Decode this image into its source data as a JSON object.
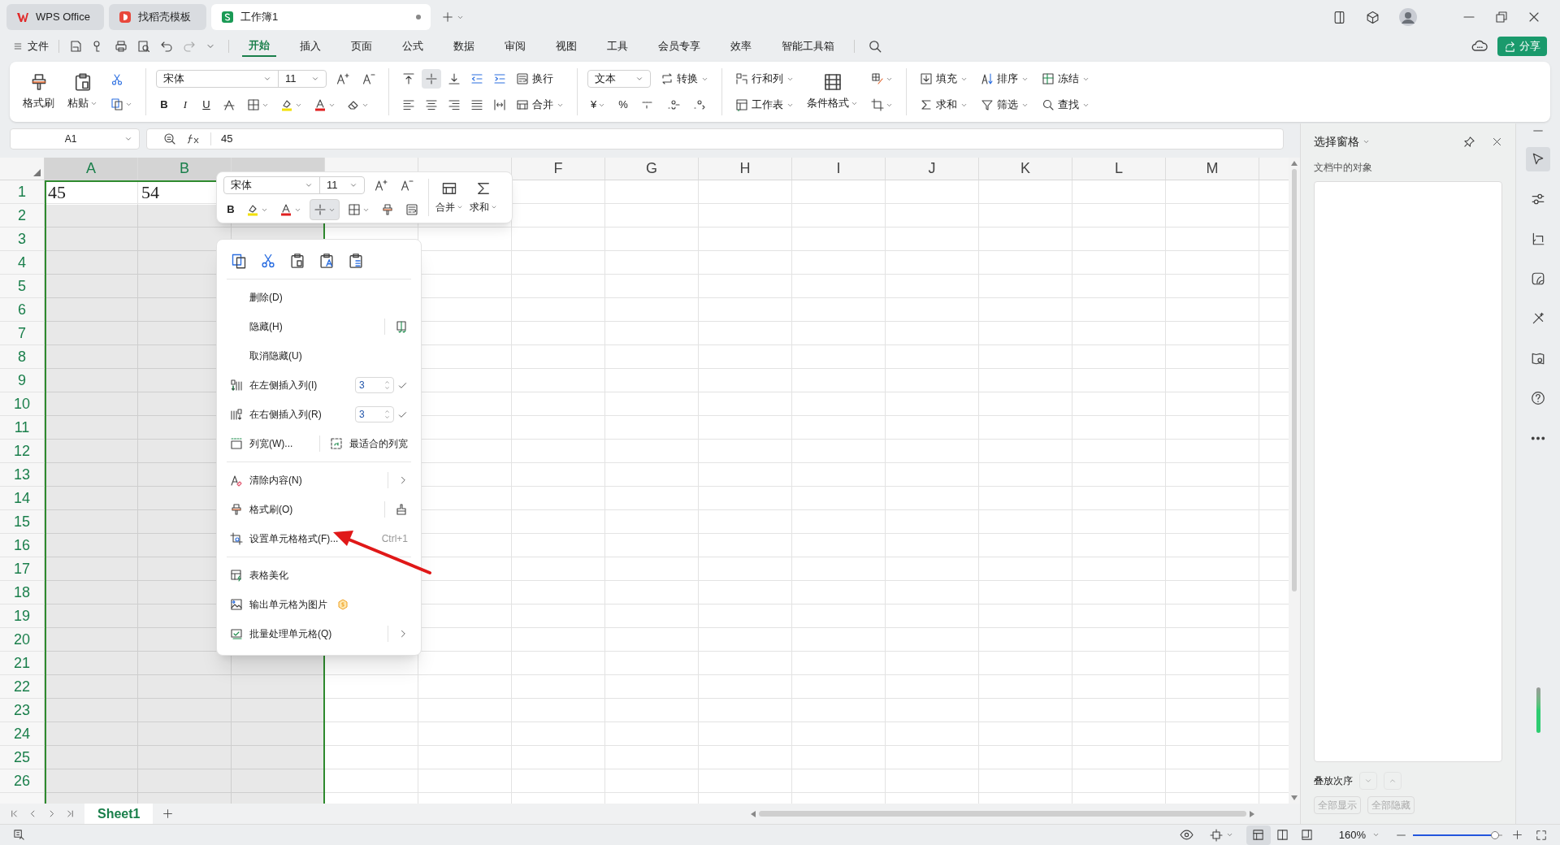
{
  "title_bar": {
    "tabs": [
      {
        "label": "WPS Office",
        "kind": "wps",
        "selected": false
      },
      {
        "label": "找稻壳模板",
        "kind": "docer",
        "selected": false
      },
      {
        "label": "工作簿1",
        "kind": "sheet",
        "selected": true
      }
    ]
  },
  "menu_bar": {
    "file": "文件",
    "tabs": [
      {
        "label": "开始",
        "selected": true
      },
      {
        "label": "插入",
        "selected": false
      },
      {
        "label": "页面",
        "selected": false
      },
      {
        "label": "公式",
        "selected": false
      },
      {
        "label": "数据",
        "selected": false
      },
      {
        "label": "审阅",
        "selected": false
      },
      {
        "label": "视图",
        "selected": false
      },
      {
        "label": "工具",
        "selected": false
      },
      {
        "label": "会员专享",
        "selected": false
      },
      {
        "label": "效率",
        "selected": false
      },
      {
        "label": "智能工具箱",
        "selected": false
      }
    ],
    "share": "分享"
  },
  "ribbon": {
    "format_painter": "格式刷",
    "paste": "粘贴",
    "font": "宋体",
    "font_size": "11",
    "text_styles": [
      "B",
      "I",
      "U"
    ],
    "align_buttons": [
      {
        "kind": "top",
        "selected": false
      },
      {
        "kind": "middle",
        "selected": true
      },
      {
        "kind": "bottom",
        "selected": false
      },
      {
        "kind": "outdent",
        "selected": false
      },
      {
        "kind": "indent",
        "selected": false
      }
    ],
    "wrap": "换行",
    "merge": "合并",
    "number_format": "文本",
    "convert": "转换",
    "currency": "¥",
    "percent": "%",
    "rows_cols": "行和列",
    "worksheet": "工作表",
    "conditional_format": "条件格式",
    "editing": [
      {
        "label": "填充",
        "kind": "fill"
      },
      {
        "label": "排序",
        "kind": "sort"
      },
      {
        "label": "冻结",
        "kind": "freeze"
      },
      {
        "label": "求和",
        "kind": "sum"
      },
      {
        "label": "筛选",
        "kind": "filter"
      },
      {
        "label": "查找",
        "kind": "find"
      }
    ]
  },
  "formula_bar": {
    "name_box": "A1",
    "formula": "45"
  },
  "sheet": {
    "columns": [
      {
        "label": "A",
        "selected": true
      },
      {
        "label": "B",
        "selected": true
      },
      {
        "selected": true
      },
      {
        "selected": false
      },
      {
        "selected": false
      },
      {
        "label": "F",
        "selected": false
      },
      {
        "label": "G",
        "selected": false
      },
      {
        "label": "H",
        "selected": false
      },
      {
        "label": "I",
        "selected": false
      },
      {
        "label": "J",
        "selected": false
      },
      {
        "label": "K",
        "selected": false
      },
      {
        "label": "L",
        "selected": false
      },
      {
        "label": "M",
        "selected": false
      }
    ],
    "rows": [
      {
        "label": "1",
        "cells": [
          "45",
          "54"
        ]
      },
      {
        "label": "2"
      },
      {
        "label": "3"
      },
      {
        "label": "4"
      },
      {
        "label": "5"
      },
      {
        "label": "6"
      },
      {
        "label": "7"
      },
      {
        "label": "8"
      },
      {
        "label": "9"
      },
      {
        "label": "10"
      },
      {
        "label": "11"
      },
      {
        "label": "12"
      },
      {
        "label": "13"
      },
      {
        "label": "14"
      },
      {
        "label": "15"
      },
      {
        "label": "16"
      },
      {
        "label": "17"
      },
      {
        "label": "18"
      },
      {
        "label": "19"
      },
      {
        "label": "20"
      },
      {
        "label": "21"
      },
      {
        "label": "22"
      },
      {
        "label": "23"
      },
      {
        "label": "24"
      },
      {
        "label": "25"
      },
      {
        "label": "26"
      },
      {}
    ]
  },
  "mini_toolbar": {
    "font": "宋体",
    "size": "11",
    "bold": "B",
    "merge": "合并",
    "sum": "求和"
  },
  "context_menu": {
    "quick_actions": [
      {
        "kind": "copy"
      },
      {
        "kind": "cut"
      },
      {
        "kind": "paste"
      },
      {
        "kind": "paste_text"
      },
      {
        "kind": "paste_special"
      }
    ],
    "sections": [
      [
        {
          "label": "删除(D)",
          "kind": "plain"
        },
        {
          "label": "隐藏(H)",
          "kind": "hide"
        },
        {
          "label": "取消隐藏(U)",
          "kind": "plain"
        },
        {
          "label": "在左侧插入列(I)",
          "kind": "insert_left",
          "count": "3"
        },
        {
          "label": "在右侧插入列(R)",
          "kind": "insert_right",
          "count": "3"
        },
        {
          "label": "列宽(W)...",
          "kind": "col_width",
          "split": "最适合的列宽"
        }
      ],
      [
        {
          "label": "清除内容(N)",
          "kind": "clear",
          "submenu": true
        },
        {
          "label": "格式刷(O)",
          "kind": "brush"
        },
        {
          "label": "设置单元格格式(F)...",
          "kind": "format",
          "shortcut": "Ctrl+1"
        }
      ],
      [
        {
          "label": "表格美化",
          "kind": "beautify"
        },
        {
          "label": "输出单元格为图片",
          "kind": "image",
          "premium": true
        },
        {
          "label": "批量处理单元格(Q)",
          "kind": "batch",
          "submenu": true
        }
      ]
    ]
  },
  "selection_pane": {
    "title": "选择窗格",
    "subtitle": "文档中的对象",
    "order_label": "叠放次序",
    "buttons": [
      {
        "label": "全部显示",
        "disabled": true
      },
      {
        "label": "全部隐藏",
        "disabled": true
      }
    ]
  },
  "side_toolbar": [
    {
      "kind": "select",
      "selected": true
    },
    {
      "kind": "properties",
      "selected": false
    },
    {
      "kind": "transform",
      "selected": false
    },
    {
      "kind": "style",
      "selected": false
    },
    {
      "kind": "tools",
      "selected": false
    },
    {
      "kind": "read",
      "selected": false
    },
    {
      "kind": "help",
      "selected": false
    },
    {
      "kind": "more",
      "selected": false
    }
  ],
  "sheet_tabs": [
    {
      "label": "Sheet1",
      "selected": true
    }
  ],
  "status_bar": {
    "zoom": "160%",
    "zoom_slider": {
      "level": 0.92
    },
    "view_modes": [
      {
        "kind": "normal",
        "selected": true
      },
      {
        "kind": "split",
        "selected": false
      },
      {
        "kind": "page",
        "selected": false
      }
    ]
  }
}
